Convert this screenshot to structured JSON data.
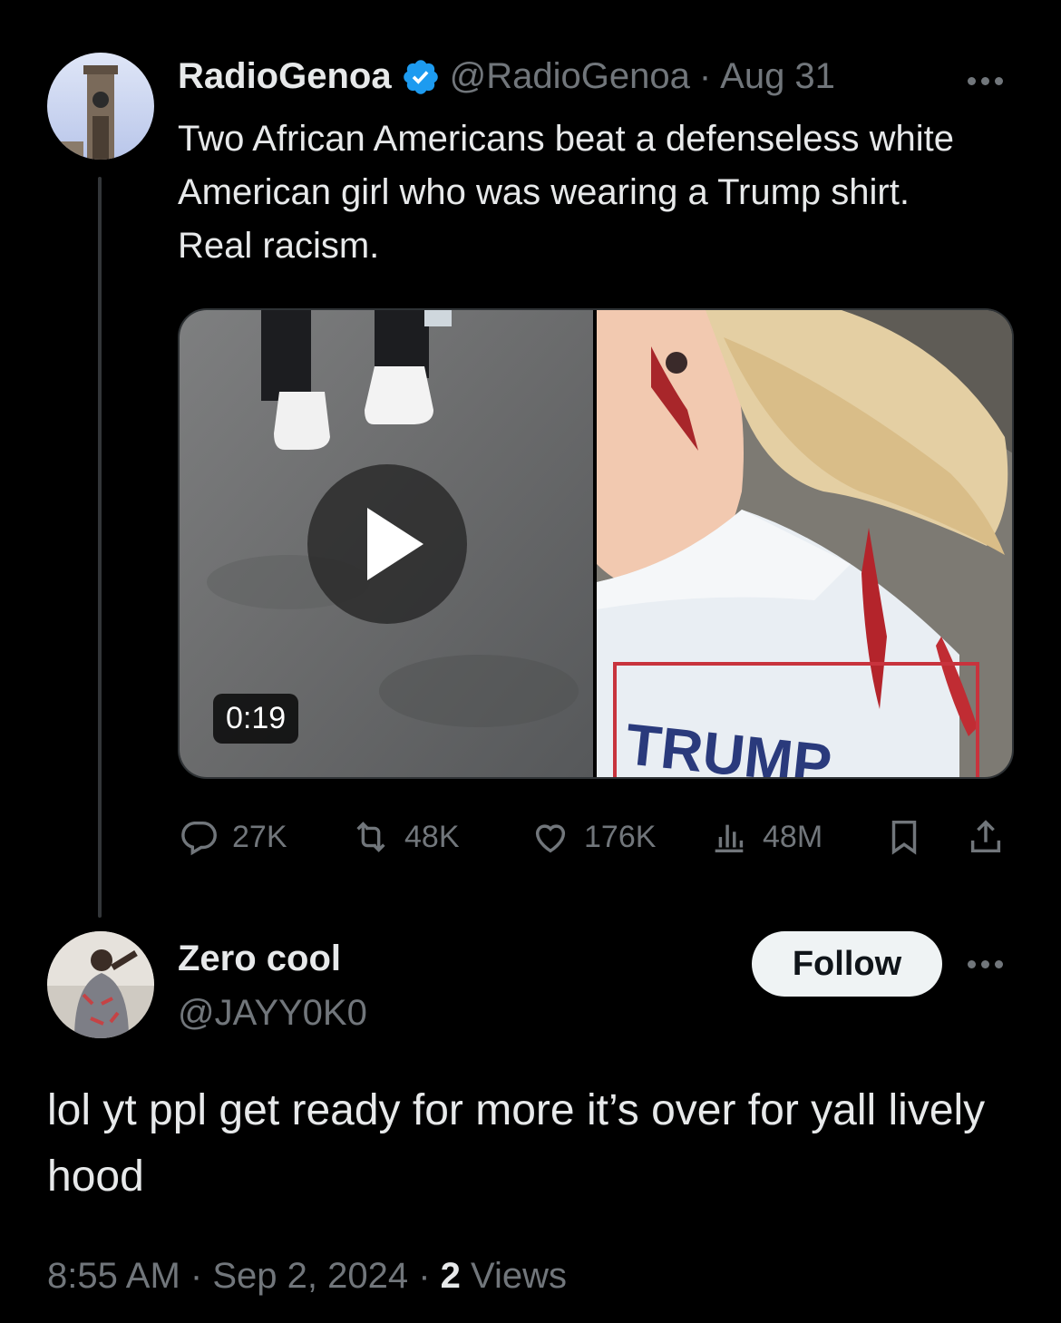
{
  "original_tweet": {
    "display_name": "RadioGenoa",
    "handle": "@RadioGenoa",
    "separator": "·",
    "date": "Aug 31",
    "verified": true,
    "text": "Two African Americans beat a defenseless white American girl who was wearing a Trump shirt. Real racism.",
    "video_duration": "0:19",
    "stats": {
      "replies": "27K",
      "reposts": "48K",
      "likes": "176K",
      "views": "48M"
    }
  },
  "reply": {
    "display_name": "Zero cool",
    "handle": "@JAYY0K0",
    "follow_label": "Follow",
    "text": "lol yt ppl get ready for more it’s over for yall lively hood",
    "time": "8:55 AM",
    "date": "Sep 2, 2024",
    "views_count": "2",
    "views_label": "Views"
  },
  "colors": {
    "background": "#000000",
    "text_primary": "#e7e9ea",
    "text_muted": "#71767b",
    "verified_badge": "#1d9bf0",
    "follow_button": "#eff3f4"
  },
  "icons": [
    "more-icon",
    "verified-icon",
    "play-icon",
    "reply-icon",
    "repost-icon",
    "like-icon",
    "views-icon",
    "bookmark-icon",
    "share-icon"
  ]
}
